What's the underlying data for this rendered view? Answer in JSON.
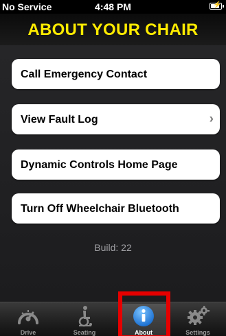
{
  "status_bar": {
    "carrier": "No Service",
    "time": "4:48 PM"
  },
  "header": {
    "title": "ABOUT YOUR CHAIR"
  },
  "menu": {
    "items": [
      {
        "label": "Call Emergency Contact"
      },
      {
        "label": "View Fault Log",
        "chevron": "›"
      },
      {
        "label": "Dynamic Controls Home Page"
      },
      {
        "label": "Turn Off Wheelchair Bluetooth"
      }
    ]
  },
  "build": {
    "label": "Build:",
    "value": "22"
  },
  "tabs": [
    {
      "label": "Drive",
      "icon": "speedometer-icon"
    },
    {
      "label": "Seating",
      "icon": "wheelchair-icon"
    },
    {
      "label": "About",
      "icon": "info-icon",
      "active": true
    },
    {
      "label": "Settings",
      "icon": "gears-icon"
    }
  ],
  "colors": {
    "header_text": "#ffeb00",
    "highlight": "#e60000",
    "info_blue": "#2c8be0"
  }
}
